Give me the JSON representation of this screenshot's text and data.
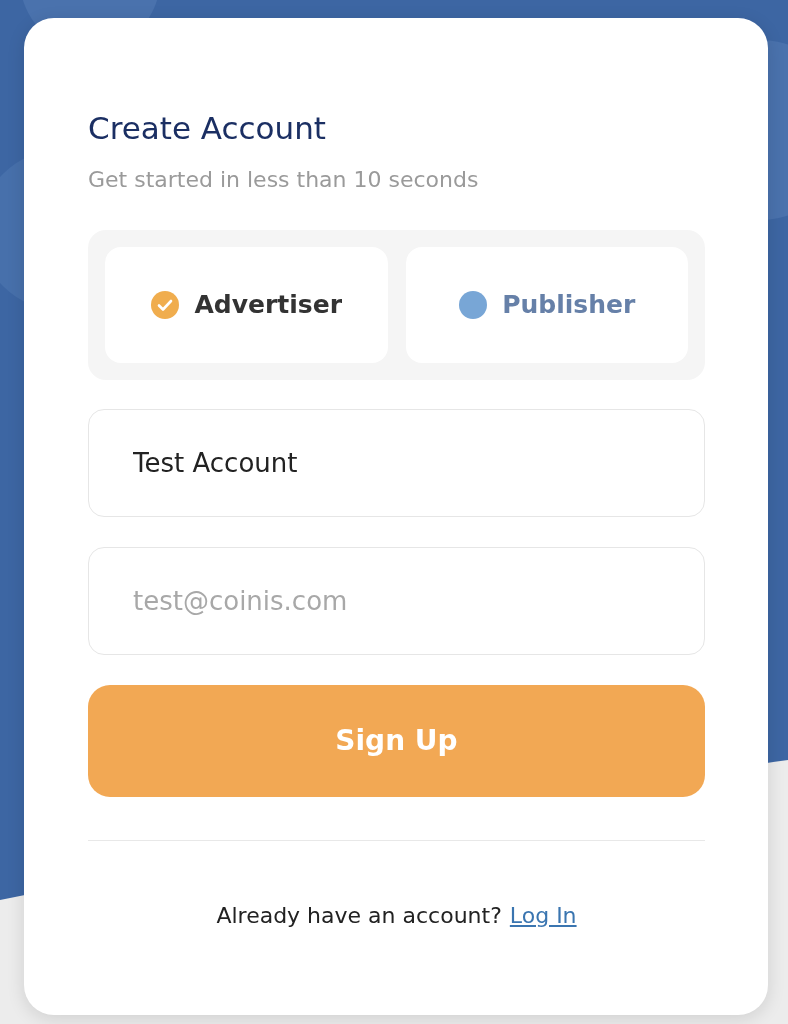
{
  "title": "Create Account",
  "subtitle": "Get started in less than 10 seconds",
  "roles": [
    {
      "label": "Advertiser",
      "selected": true
    },
    {
      "label": "Publisher",
      "selected": false
    }
  ],
  "fields": [
    {
      "value": "Test Account"
    },
    {
      "placeholder": "test@coinis.com"
    }
  ],
  "submit_button": "Sign Up",
  "footer": {
    "text": "Already have an account?",
    "link": "Log In"
  }
}
